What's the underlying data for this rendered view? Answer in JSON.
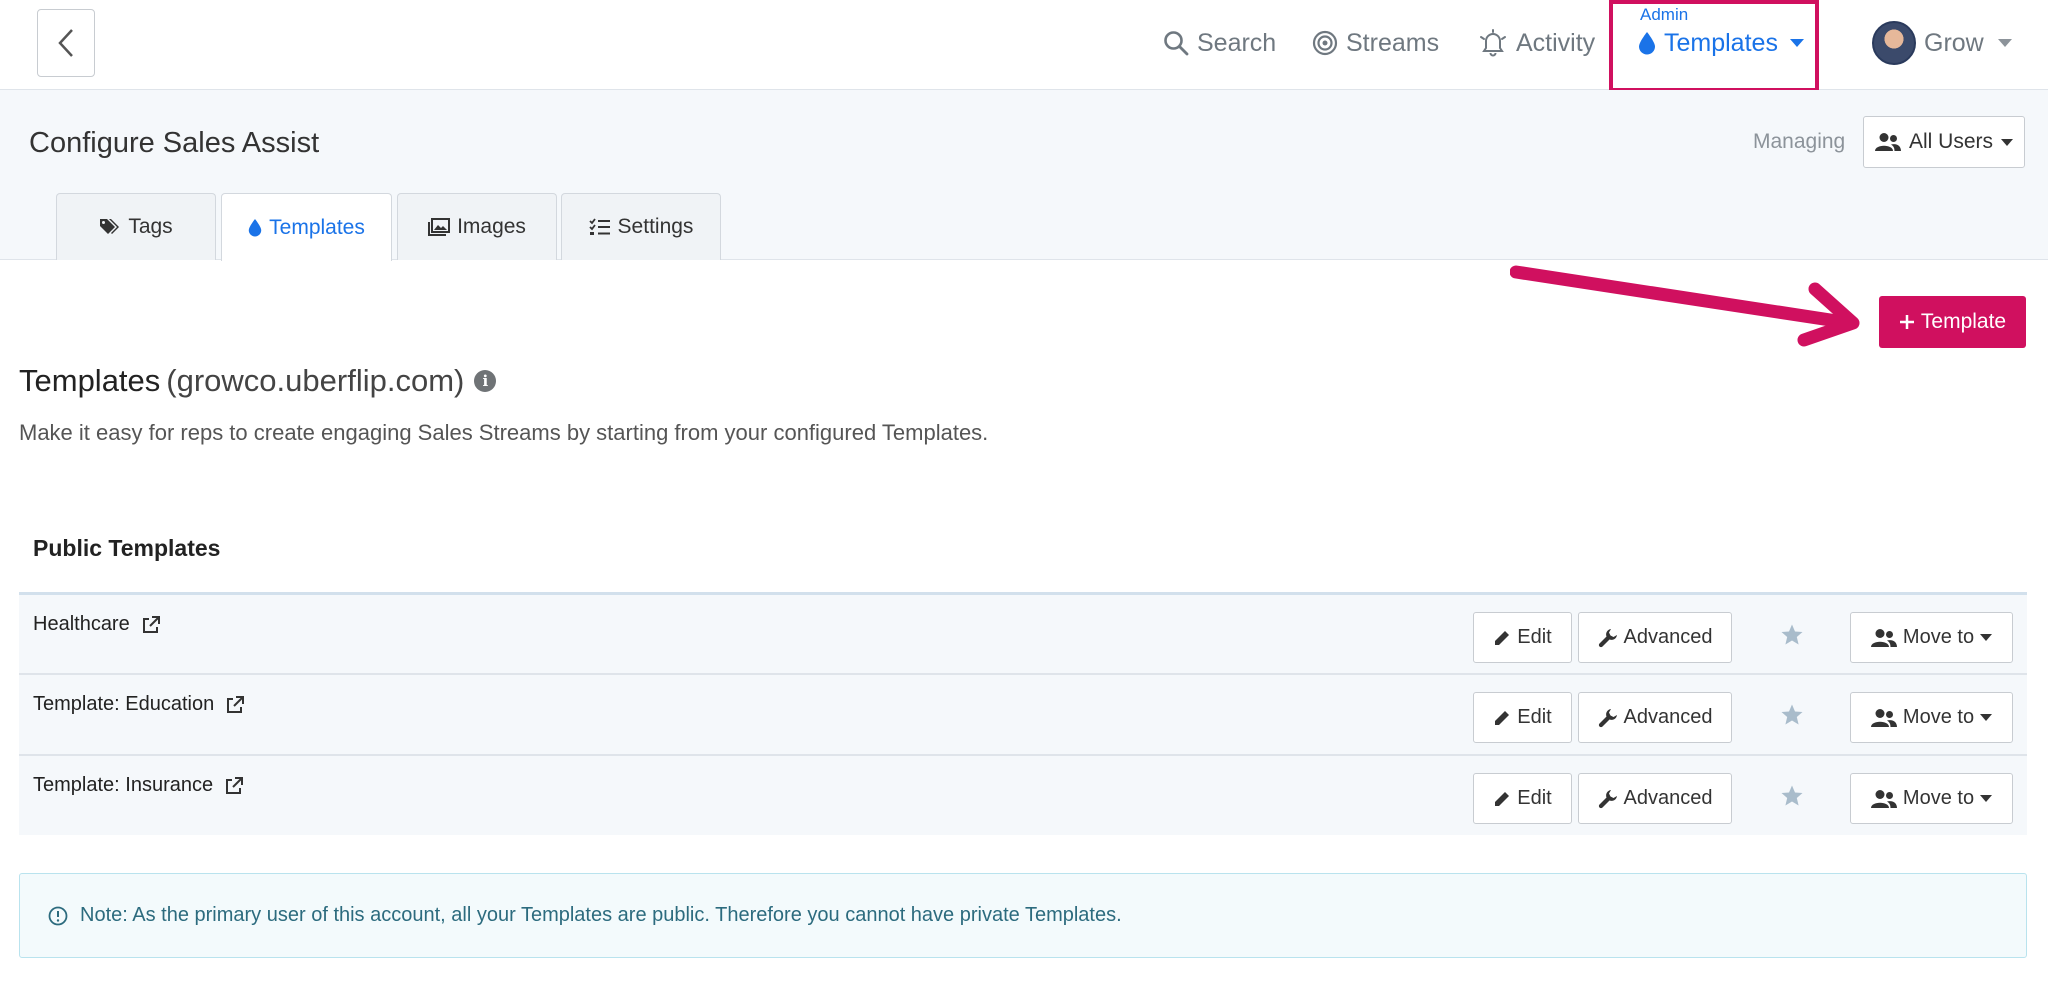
{
  "nav": {
    "search": "Search",
    "streams": "Streams",
    "activity": "Activity",
    "admin_label": "Admin",
    "templates": "Templates",
    "user": "Grow"
  },
  "header": {
    "title": "Configure Sales Assist",
    "managing_label": "Managing",
    "all_users": "All Users"
  },
  "tabs": [
    {
      "label": "Tags",
      "icon": "tags-icon"
    },
    {
      "label": "Templates",
      "icon": "droplet-icon",
      "active": true
    },
    {
      "label": "Images",
      "icon": "images-icon"
    },
    {
      "label": "Settings",
      "icon": "checklist-icon"
    }
  ],
  "main": {
    "add_button": "Template",
    "section_title": "Templates",
    "section_domain": "(growco.uberflip.com)",
    "description": "Make it easy for reps to create engaging Sales Streams by starting from your configured Templates.",
    "public_title": "Public Templates",
    "templates": [
      {
        "name": "Healthcare"
      },
      {
        "name": "Template: Education"
      },
      {
        "name": "Template: Insurance"
      }
    ],
    "row_actions": {
      "edit": "Edit",
      "advanced": "Advanced",
      "move_to": "Move to"
    },
    "note": "Note: As the primary user of this account, all your Templates are public. Therefore you cannot have private Templates."
  },
  "colors": {
    "accent": "#1a73e8",
    "brand": "#d0105f",
    "note_text": "#2c6b7e"
  }
}
